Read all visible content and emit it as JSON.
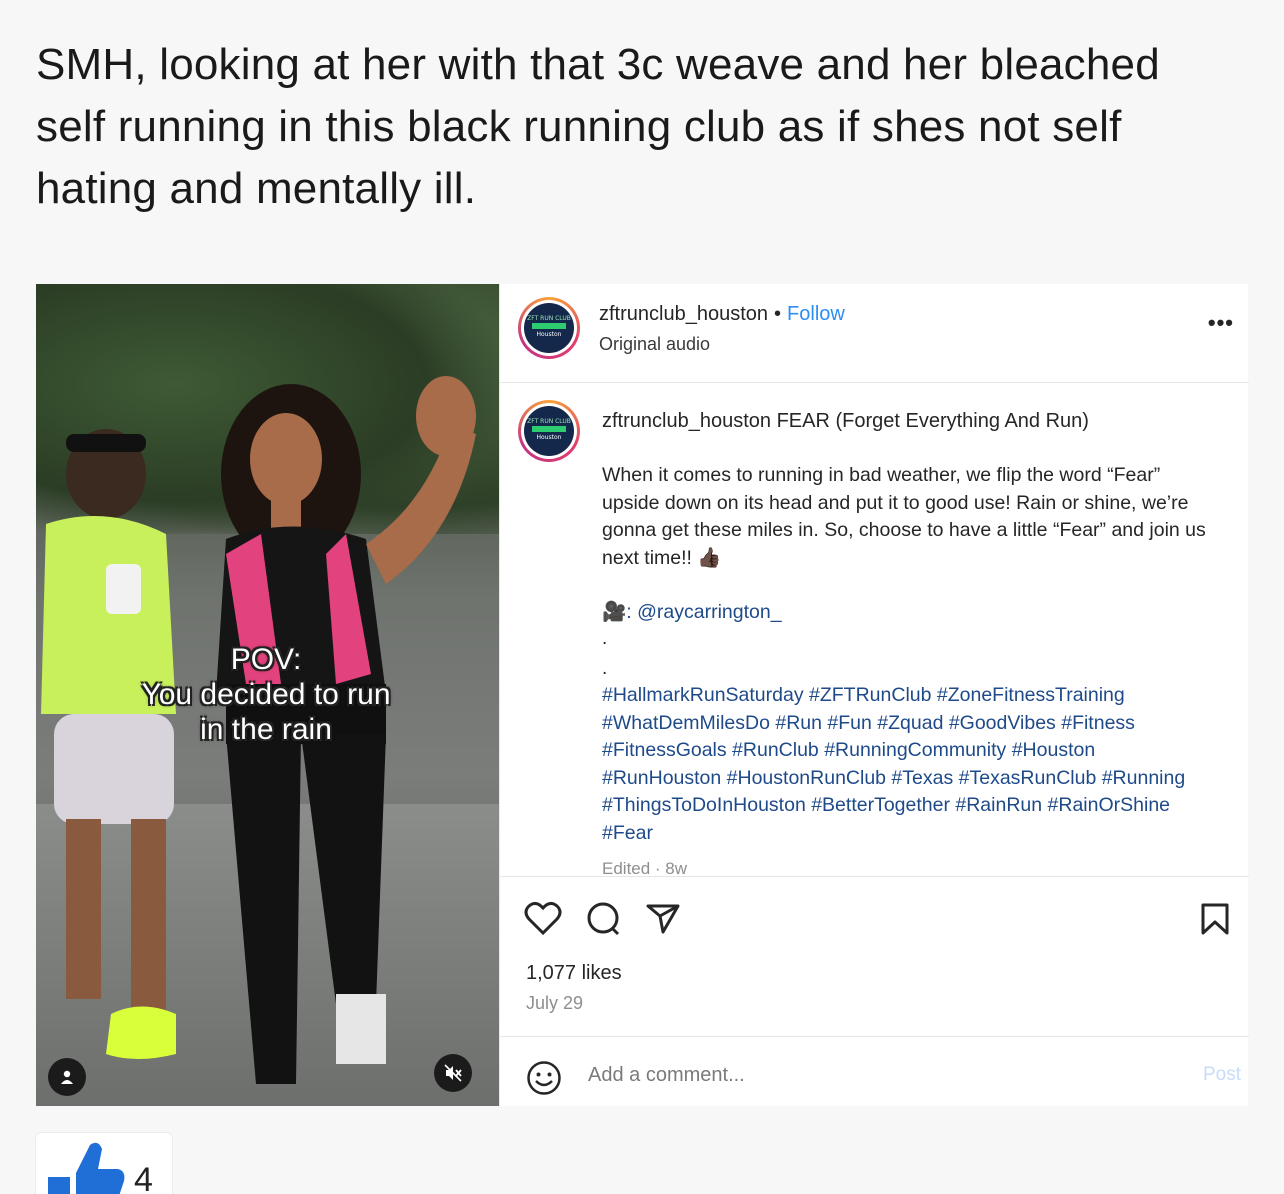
{
  "post": {
    "text": "SMH, looking at her with that 3c weave and her bleached self running in this black running club as if shes not self hating and mentally ill."
  },
  "media": {
    "overlay_line1": "POV:",
    "overlay_line2": "You decided to run",
    "overlay_line3": "in the rain",
    "user_icon": "person-icon",
    "mute_icon": "speaker-muted-icon"
  },
  "instagram": {
    "username": "zftrunclub_houston",
    "separator": "•",
    "follow_label": "Follow",
    "audio_label": "Original audio",
    "more_label": "•••",
    "caption_username": "zftrunclub_houston",
    "caption_title": "FEAR (Forget Everything And Run)",
    "caption_body": "When it comes to running in bad weather, we flip the word “Fear” upside down on its head and put it to good use! Rain or shine, we’re gonna get these miles in. So, choose to have a little “Fear” and join us next time!! 👍🏿",
    "credit": "🎥: @raycarrington_",
    "dots": ".\n.",
    "hashtags": "#HallmarkRunSaturday #ZFTRunClub #ZoneFitnessTraining #WhatDemMilesDo #Run #Fun #Zquad #GoodVibes #Fitness #FitnessGoals #RunClub #RunningCommunity #Houston #RunHouston #HoustonRunClub #Texas #TexasRunClub #Running #ThingsToDoInHouston #BetterTogether #RainRun #RainOrShine #Fear",
    "edited": "Edited · 8w",
    "likes": "1,077 likes",
    "date": "July 29",
    "comment_placeholder": "Add a comment...",
    "post_label": "Post",
    "avatar_text": "ZFT RUN CLUB",
    "avatar_sub": "Houston"
  },
  "reaction": {
    "count": "4",
    "icon": "thumbs-up-icon",
    "color": "#1f6fd6"
  }
}
